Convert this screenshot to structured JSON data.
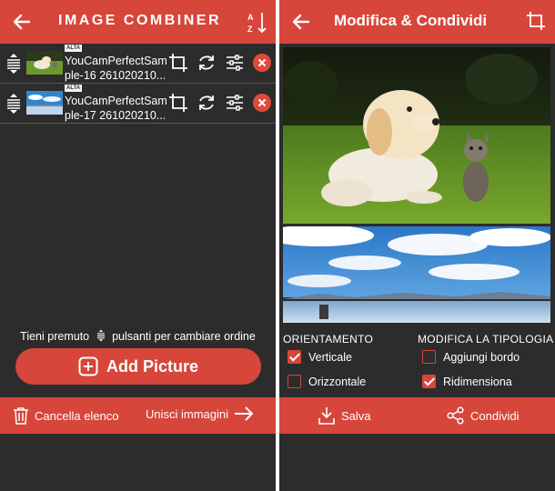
{
  "left": {
    "title": "IMAGE COMBINER",
    "items": [
      {
        "badge": "ALTA",
        "name_line1": "YouCamPerfectSam",
        "name_line2": "ple-16 261020210..."
      },
      {
        "badge": "ALTA",
        "name_line1": "YouCamPerfectSam",
        "name_line2": "ple-17 261020210..."
      }
    ],
    "hint_before": "Tieni premuto",
    "hint_after": "pulsanti per cambiare ordine",
    "add_picture": "Add Picture",
    "clear_list": "Cancella elenco",
    "merge_images": "Unisci immagini"
  },
  "right": {
    "title": "Modifica & Condividi",
    "orientation_label": "ORIENTAMENTO",
    "orientation_options": [
      {
        "label": "Verticale",
        "checked": true
      },
      {
        "label": "Orizzontale",
        "checked": false
      }
    ],
    "type_label": "MODIFICA LA TIPOLOGIA",
    "type_options": [
      {
        "label": "Aggiungi bordo",
        "checked": false
      },
      {
        "label": "Ridimensiona",
        "checked": true
      }
    ],
    "save": "Salva",
    "share": "Condividi"
  },
  "colors": {
    "accent": "#d7463a",
    "background": "#2c2c2c"
  }
}
